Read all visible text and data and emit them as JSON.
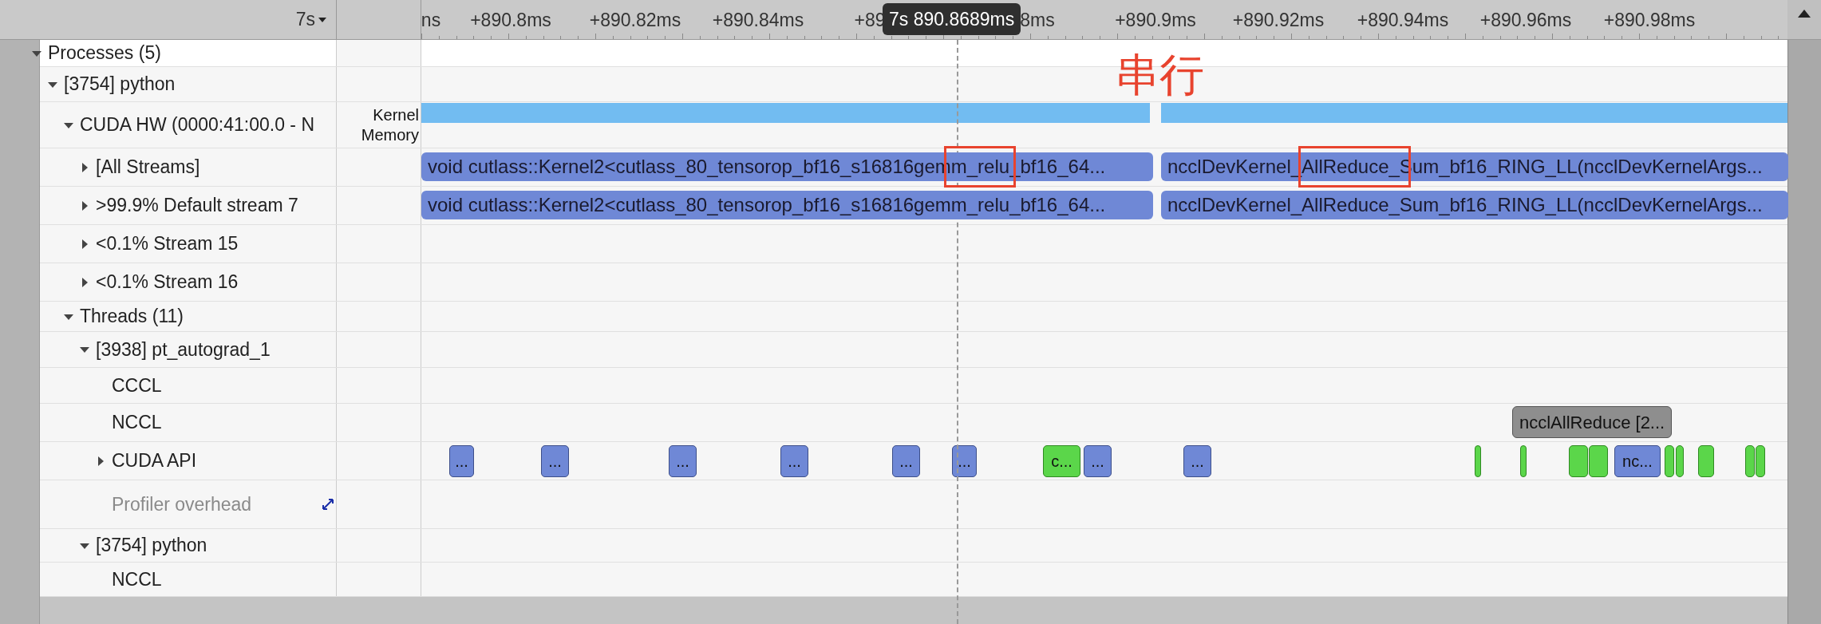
{
  "ruler": {
    "zoom_label": "7s",
    "ticks": [
      "ns",
      "+890.8ms",
      "+890.82ms",
      "+890.84ms",
      "+89",
      "8ms",
      "+890.9ms",
      "+890.92ms",
      "+890.94ms",
      "+890.96ms",
      "+890.98ms"
    ],
    "cursor_time": "7s 890.8689ms"
  },
  "annotation": {
    "label": "串行"
  },
  "tree": [
    {
      "label": "Processes (5)",
      "expanded": true,
      "children": [
        {
          "label": "[3754] python",
          "expanded": true,
          "children": [
            {
              "label": "CUDA HW (0000:41:00.0 - N",
              "expanded": true,
              "side_labels": [
                "Kernel",
                "Memory"
              ],
              "children": [
                {
                  "label": "[All Streams]",
                  "expanded": false,
                  "kernels": [
                    {
                      "label": "void cutlass::Kernel2<cutlass_80_tensorop_bf16_s16816gemm_relu_bf16_64...",
                      "highlighted": true
                    },
                    {
                      "label": "ncclDevKernel_AllReduce_Sum_bf16_RING_LL(ncclDevKernelArgs...",
                      "highlighted": true
                    }
                  ]
                },
                {
                  "label": ">99.9% Default stream 7",
                  "expanded": false,
                  "kernels": [
                    {
                      "label": "void cutlass::Kernel2<cutlass_80_tensorop_bf16_s16816gemm_relu_bf16_64...",
                      "highlighted": false
                    },
                    {
                      "label": "ncclDevKernel_AllReduce_Sum_bf16_RING_LL(ncclDevKernelArgs...",
                      "highlighted": false
                    }
                  ]
                },
                {
                  "label": "<0.1% Stream 15",
                  "expanded": false
                },
                {
                  "label": "<0.1% Stream 16",
                  "expanded": false
                }
              ]
            },
            {
              "label": "Threads (11)",
              "expanded": true,
              "children": [
                {
                  "label": "[3938] pt_autograd_1",
                  "expanded": true,
                  "children": [
                    {
                      "label": "CCCL",
                      "dimmed": false
                    },
                    {
                      "label": "NCCL",
                      "dimmed": false,
                      "popup": "ncclAllReduce [2..."
                    },
                    {
                      "label": "CUDA API",
                      "dimmed": false,
                      "expanded": false,
                      "events": [
                        {
                          "kind": "api",
                          "label": "..."
                        },
                        {
                          "kind": "api",
                          "label": "..."
                        },
                        {
                          "kind": "api",
                          "label": "..."
                        },
                        {
                          "kind": "api",
                          "label": "..."
                        },
                        {
                          "kind": "api",
                          "label": "..."
                        },
                        {
                          "kind": "api",
                          "label": "..."
                        },
                        {
                          "kind": "sync",
                          "label": "c..."
                        },
                        {
                          "kind": "api",
                          "label": "..."
                        },
                        {
                          "kind": "api",
                          "label": "..."
                        },
                        {
                          "kind": "sync"
                        },
                        {
                          "kind": "sync"
                        },
                        {
                          "kind": "sync"
                        },
                        {
                          "kind": "sync"
                        },
                        {
                          "kind": "api",
                          "label": "nc..."
                        },
                        {
                          "kind": "sync"
                        },
                        {
                          "kind": "sync"
                        },
                        {
                          "kind": "sync"
                        },
                        {
                          "kind": "sync"
                        },
                        {
                          "kind": "sync"
                        }
                      ]
                    },
                    {
                      "label": "Profiler overhead",
                      "dimmed": true
                    }
                  ]
                },
                {
                  "label": "[3754] python",
                  "expanded": true,
                  "children": [
                    {
                      "label": "NCCL"
                    }
                  ]
                }
              ]
            }
          ]
        }
      ]
    }
  ]
}
